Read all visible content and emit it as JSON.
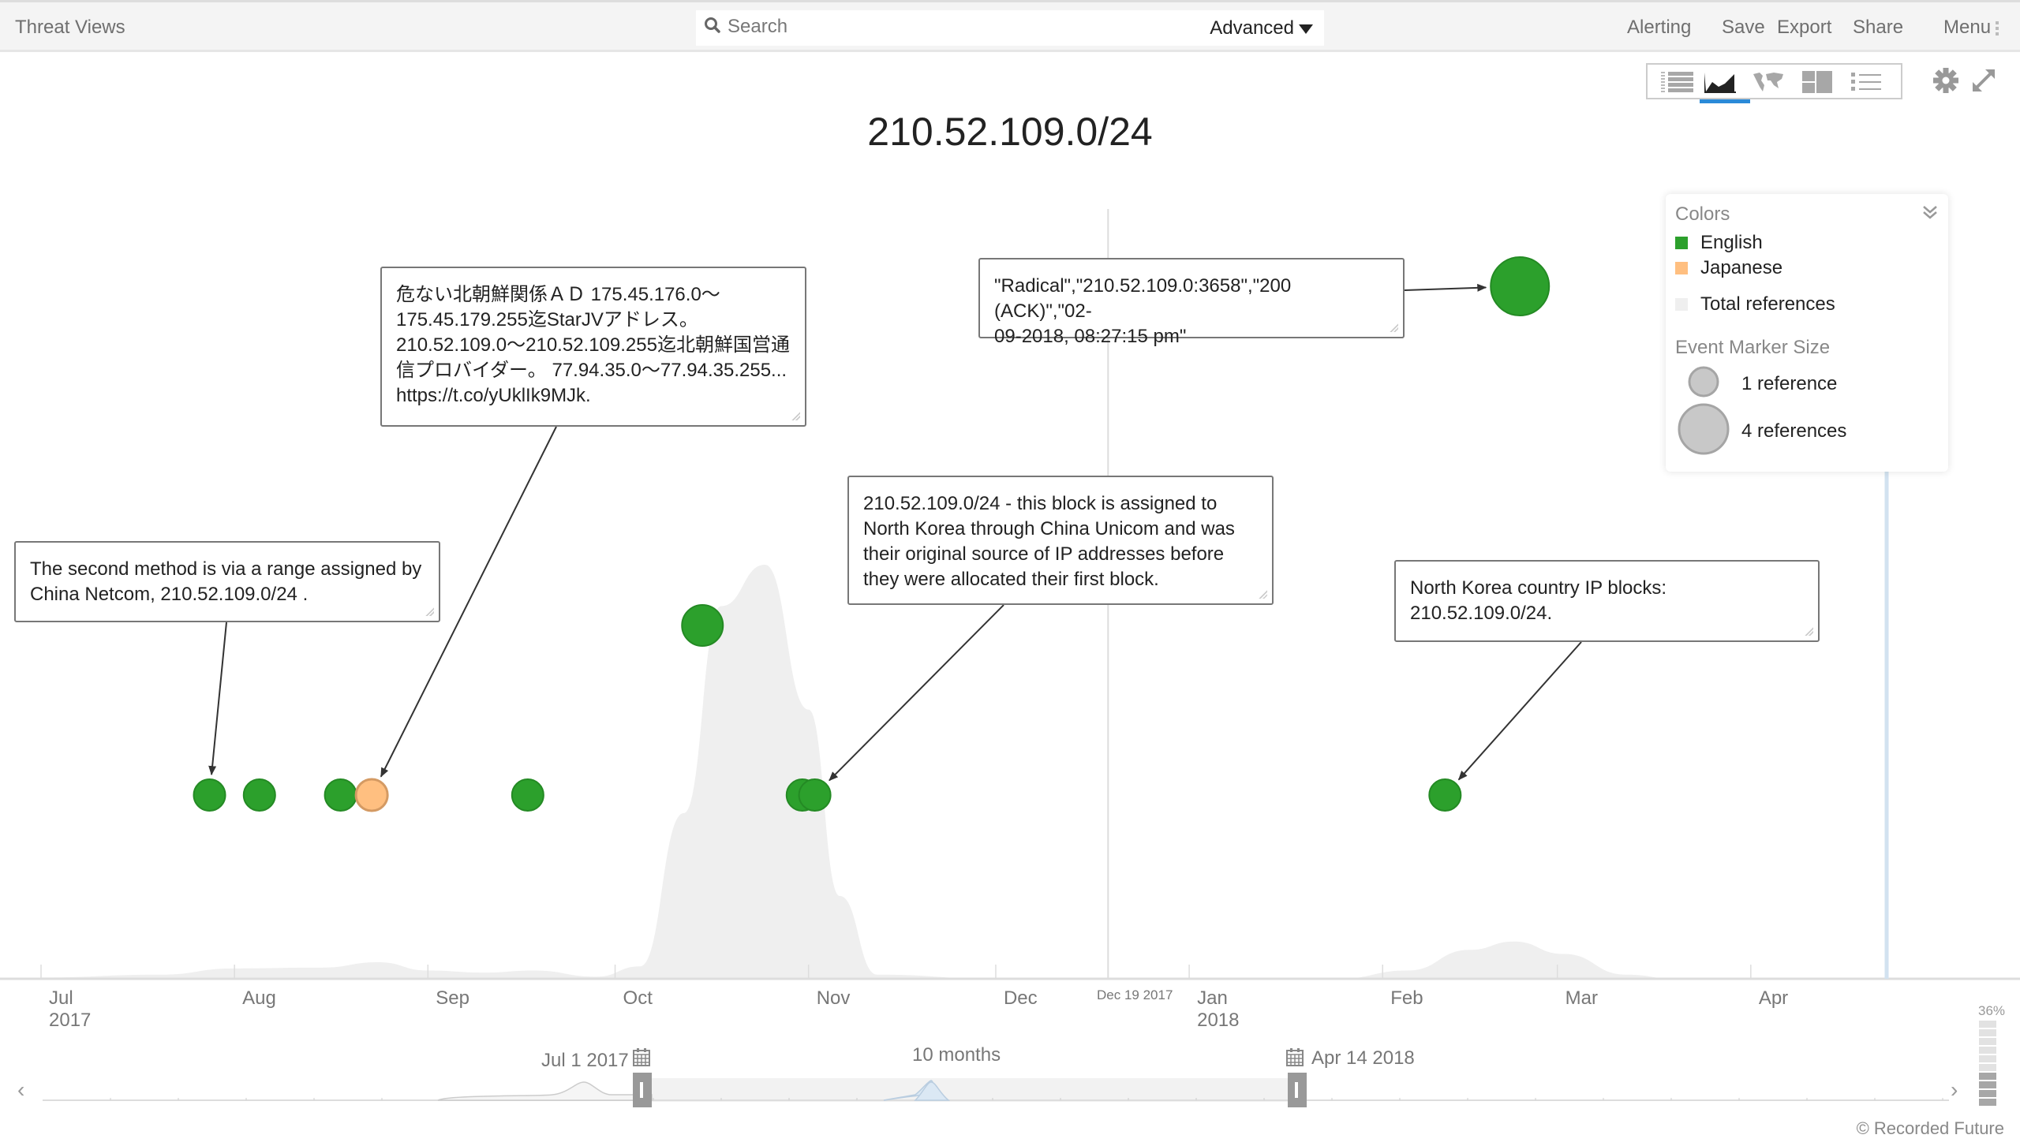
{
  "app": {
    "title": "Threat Views",
    "search_placeholder": "Search",
    "advanced_label": "Advanced",
    "nav": [
      "Alerting",
      "Save",
      "Export",
      "Share",
      "Menu"
    ]
  },
  "toolbar": {
    "views": [
      {
        "name": "table-view",
        "icon": "table-icon",
        "active": false
      },
      {
        "name": "timeline-view",
        "icon": "area-chart-icon",
        "active": true
      },
      {
        "name": "map-view",
        "icon": "world-map-icon",
        "active": false
      },
      {
        "name": "panel-view",
        "icon": "panels-icon",
        "active": false
      },
      {
        "name": "list-view",
        "icon": "list-icon",
        "active": false
      }
    ],
    "settings_icon": "gear-icon",
    "fullscreen_icon": "expand-icon"
  },
  "page_title": "210.52.109.0/24",
  "colors": {
    "english": "#2ca02c",
    "japanese": "#ffbf80",
    "total_references": "#efefef",
    "accent": "#2a8ad8"
  },
  "legend": {
    "colors_header": "Colors",
    "items": [
      {
        "label": "English",
        "color": "#2ca02c"
      },
      {
        "label": "Japanese",
        "color": "#ffbf80"
      },
      {
        "label": "Total references",
        "color": "#efefef"
      }
    ],
    "size_header": "Event Marker Size",
    "sizes": [
      {
        "label": "1 reference",
        "refs": 1
      },
      {
        "label": "4 references",
        "refs": 4
      }
    ]
  },
  "annotations": [
    {
      "id": "a1",
      "text": "The second method is via a range assigned by China Netcom, 210.52.109.0/24 .",
      "target_event": 0
    },
    {
      "id": "a2",
      "text": "危ない北朝鮮関係ＡＤ 175.45.176.0～175.45.179.255迄StarJVアドレス。210.52.109.0～210.52.109.255迄北朝鮮国営通信プロバイダー。 77.94.35.0～77.94.35.255... https://t.co/yUklIk9MJk.",
      "lines": [
        "危ない北朝鮮関係ＡＤ 175.45.176.0～",
        "175.45.179.255迄StarJVアドレス。",
        "210.52.109.0～210.52.109.255迄北朝鮮国営通",
        "信プロバイダー。 77.94.35.0～77.94.35.255...",
        "https://t.co/yUklIk9MJk."
      ],
      "target_event": 3
    },
    {
      "id": "a3",
      "text": "\"Radical\",\"210.52.109.0:3658\",\"200 (ACK)\",\"02-09-2018, 08:27:15 pm\"",
      "lines": [
        "\"Radical\",\"210.52.109.0:3658\",\"200 (ACK)\",\"02-",
        "09-2018, 08:27:15 pm\""
      ],
      "target_event": 9
    },
    {
      "id": "a4",
      "text": "210.52.109.0/24 - this block is assigned to North Korea through China Unicom and was their original source of IP addresses before they were allocated their first block.",
      "lines": [
        "210.52.109.0/24 - this block is assigned to",
        "North Korea through China Unicom and was",
        "their original source of IP addresses before",
        "they were allocated their first block."
      ],
      "target_event": 7
    },
    {
      "id": "a5",
      "text": "North Korea country IP blocks: 210.52.109.0/24.",
      "lines": [
        "North Korea country IP blocks:",
        "210.52.109.0/24."
      ],
      "target_event": 8
    }
  ],
  "chart_data": {
    "type": "scatter",
    "title": "210.52.109.0/24",
    "x_range": [
      "2017-07-01",
      "2018-04-14"
    ],
    "x_ticks": [
      {
        "label": "Jul",
        "year": "2017",
        "date": "2017-07-01"
      },
      {
        "label": "Aug",
        "year": "",
        "date": "2017-08-01"
      },
      {
        "label": "Sep",
        "year": "",
        "date": "2017-09-01"
      },
      {
        "label": "Oct",
        "year": "",
        "date": "2017-10-01"
      },
      {
        "label": "Nov",
        "year": "",
        "date": "2017-11-01"
      },
      {
        "label": "Dec",
        "year": "",
        "date": "2017-12-01"
      },
      {
        "label": "Jan",
        "year": "2018",
        "date": "2018-01-01"
      },
      {
        "label": "Feb",
        "year": "",
        "date": "2018-02-01"
      },
      {
        "label": "Mar",
        "year": "",
        "date": "2018-03-01"
      },
      {
        "label": "Apr",
        "year": "",
        "date": "2018-04-01"
      }
    ],
    "today_marker": {
      "label": "Dec 19 2017",
      "date": "2017-12-19"
    },
    "events": [
      {
        "date": "2017-07-28",
        "language": "English",
        "refs": 1,
        "lane": 0
      },
      {
        "date": "2017-08-05",
        "language": "English",
        "refs": 1,
        "lane": 0
      },
      {
        "date": "2017-08-18",
        "language": "English",
        "refs": 1,
        "lane": 0
      },
      {
        "date": "2017-08-23",
        "language": "Japanese",
        "refs": 1,
        "lane": 0
      },
      {
        "date": "2017-09-17",
        "language": "English",
        "refs": 1,
        "lane": 0
      },
      {
        "date": "2017-10-15",
        "language": "English",
        "refs": 2,
        "lane": 1
      },
      {
        "date": "2017-10-31",
        "language": "English",
        "refs": 1,
        "lane": 0
      },
      {
        "date": "2017-11-02",
        "language": "English",
        "refs": 1,
        "lane": 0
      },
      {
        "date": "2018-02-11",
        "language": "English",
        "refs": 1,
        "lane": 0
      },
      {
        "date": "2018-02-23",
        "language": "English",
        "refs": 4,
        "lane": 2
      }
    ],
    "total_references_density": [
      {
        "date": "2017-07-01",
        "value": 0.3
      },
      {
        "date": "2017-07-20",
        "value": 1.0
      },
      {
        "date": "2017-08-01",
        "value": 2.5
      },
      {
        "date": "2017-08-15",
        "value": 2.7
      },
      {
        "date": "2017-08-24",
        "value": 4.0
      },
      {
        "date": "2017-09-01",
        "value": 2.0
      },
      {
        "date": "2017-09-10",
        "value": 1.5
      },
      {
        "date": "2017-09-18",
        "value": 2.0
      },
      {
        "date": "2017-09-28",
        "value": 0.5
      },
      {
        "date": "2017-10-05",
        "value": 3
      },
      {
        "date": "2017-10-12",
        "value": 40
      },
      {
        "date": "2017-10-18",
        "value": 90
      },
      {
        "date": "2017-10-25",
        "value": 100
      },
      {
        "date": "2017-11-01",
        "value": 65
      },
      {
        "date": "2017-11-06",
        "value": 20
      },
      {
        "date": "2017-11-12",
        "value": 1
      },
      {
        "date": "2017-12-01",
        "value": 0
      },
      {
        "date": "2018-01-25",
        "value": 0
      },
      {
        "date": "2018-02-05",
        "value": 2
      },
      {
        "date": "2018-02-15",
        "value": 7
      },
      {
        "date": "2018-02-22",
        "value": 9
      },
      {
        "date": "2018-03-02",
        "value": 6
      },
      {
        "date": "2018-03-12",
        "value": 1
      },
      {
        "date": "2018-03-20",
        "value": 0
      },
      {
        "date": "2018-04-14",
        "value": 0
      }
    ]
  },
  "range_selector": {
    "start_label": "Jul 1 2017",
    "end_label": "Apr 14 2018",
    "span_label": "10 months"
  },
  "zoom_level": {
    "label": "36%",
    "value": 0.36,
    "segments_total": 10,
    "segments_filled": 4
  },
  "footer": {
    "copyright": "© Recorded Future"
  }
}
